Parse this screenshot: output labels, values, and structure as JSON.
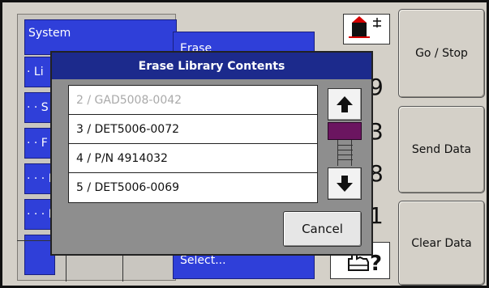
{
  "side_buttons": {
    "go_stop": "Go / Stop",
    "send_data": "Send Data",
    "clear_data": "Clear Data"
  },
  "menu": {
    "system": "System",
    "sub1": "· Li",
    "sub2": "· · S",
    "sub3": "· · F",
    "sub4": "· · · I",
    "sub5": "· · · I",
    "erase": "Erase",
    "select": "Select..."
  },
  "background_digits": [
    "9",
    "3",
    "8",
    "1"
  ],
  "dialog": {
    "title": "Erase Library Contents",
    "items": [
      {
        "label": "2 / GAD5008-0042",
        "enabled": false
      },
      {
        "label": "3 / DET5006-0072",
        "enabled": true
      },
      {
        "label": "4 / P/N 4914032",
        "enabled": true
      },
      {
        "label": "5 / DET5006-0069",
        "enabled": true
      }
    ],
    "cancel": "Cancel"
  },
  "icons": {
    "mode": "instrument-mode-icon",
    "help": "hand-help-icon",
    "up": "arrow-up-icon",
    "down": "arrow-down-icon"
  },
  "colors": {
    "menu_blue": "#2f3fd9",
    "title_blue": "#1c2a8c",
    "scroll_thumb": "#6b1560",
    "dialog_gray": "#8e8e8e"
  }
}
